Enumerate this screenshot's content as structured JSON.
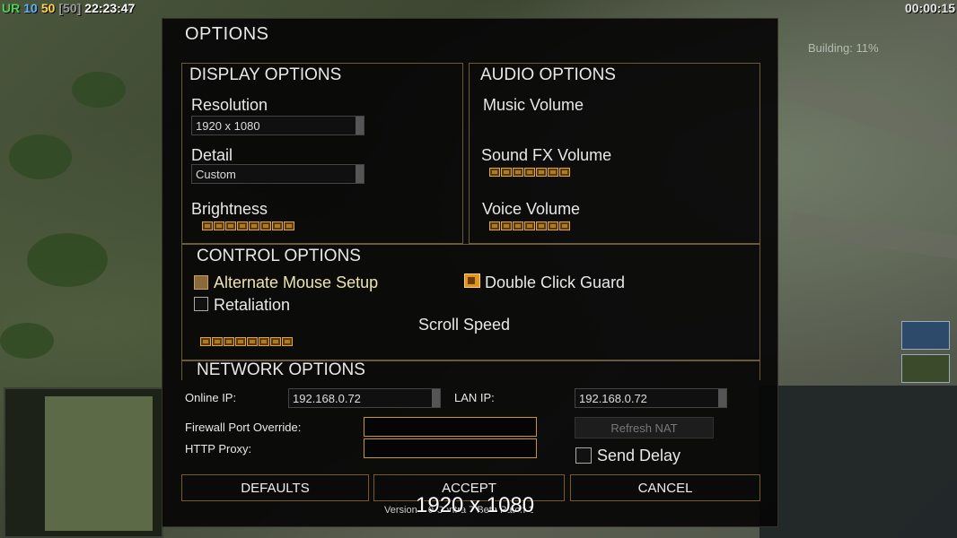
{
  "hud": {
    "ur": "UR",
    "v1": "10",
    "v2": "50",
    "v3": "[50]",
    "time": "22:23:47",
    "game_timer": "00:00:15",
    "building": "Building: 11%"
  },
  "dialog": {
    "title": "OPTIONS",
    "display": {
      "title": "DISPLAY OPTIONS",
      "resolution_label": "Resolution",
      "resolution_value": "1920 x 1080",
      "detail_label": "Detail",
      "detail_value": "Custom",
      "brightness_label": "Brightness",
      "brightness_level": 0.6
    },
    "audio": {
      "title": "AUDIO OPTIONS",
      "music_label": "Music Volume",
      "music_level": 0,
      "sfx_label": "Sound FX Volume",
      "sfx_level": 0.5,
      "voice_label": "Voice Volume",
      "voice_level": 0.5
    },
    "control": {
      "title": "CONTROL OPTIONS",
      "alt_mouse_label": "Alternate Mouse Setup",
      "alt_mouse_checked": true,
      "double_click_label": "Double Click Guard",
      "double_click_checked": true,
      "retaliation_label": "Retaliation",
      "retaliation_checked": false,
      "scroll_label": "Scroll Speed",
      "scroll_level": 0.6
    },
    "network": {
      "title": "NETWORK OPTIONS",
      "online_ip_label": "Online IP:",
      "online_ip_value": "192.168.0.72",
      "lan_ip_label": "LAN IP:",
      "lan_ip_value": "192.168.0.72",
      "firewall_label": "Firewall Port Override:",
      "firewall_value": "",
      "proxy_label": "HTTP Proxy:",
      "proxy_value": "",
      "refresh_nat": "Refresh NAT",
      "send_delay_label": "Send Delay",
      "send_delay_checked": false
    },
    "buttons": {
      "defaults": "DEFAULTS",
      "accept": "ACCEPT",
      "cancel": "CANCEL"
    },
    "version": "Version 1.0 Contra 7 Beta Patch 1",
    "overlay_resolution": "1920 x 1080"
  },
  "colors": {
    "slider": "#b07a1e",
    "border": "#6a5a3a",
    "accent": "#e0961a"
  }
}
